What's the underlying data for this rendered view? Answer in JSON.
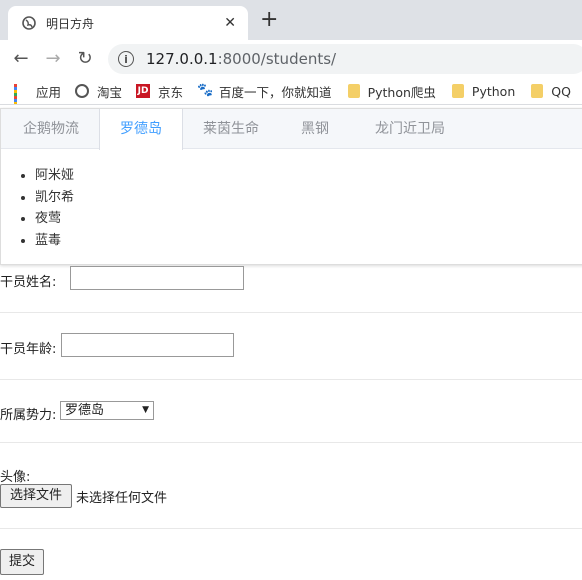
{
  "browser": {
    "tab_title": "明日方舟",
    "tab_close": "✕",
    "new_tab": "+",
    "back": "←",
    "forward": "→",
    "reload": "↻",
    "info": "i",
    "url_host": "127.0.0.1",
    "url_rest": ":8000/students/"
  },
  "bookmarks": [
    {
      "label": "应用",
      "icon": "apps-grid-icon"
    },
    {
      "label": "淘宝",
      "icon": "globe-icon"
    },
    {
      "label": "京东",
      "icon": "jd-icon"
    },
    {
      "label": "百度一下，你就知道",
      "icon": "baidu-paw-icon"
    },
    {
      "label": "Python爬虫",
      "icon": "folder-icon"
    },
    {
      "label": "Python",
      "icon": "folder-icon"
    },
    {
      "label": "QQ",
      "icon": "folder-icon"
    }
  ],
  "tabs": [
    {
      "label": "企鹅物流"
    },
    {
      "label": "罗德岛"
    },
    {
      "label": "莱茵生命"
    },
    {
      "label": "黑钢"
    },
    {
      "label": "龙门近卫局"
    }
  ],
  "active_tab": "罗德岛",
  "members": [
    "阿米娅",
    "凯尔希",
    "夜莺",
    "蓝毒"
  ],
  "form": {
    "name_label": "干员姓名:",
    "name_value": "",
    "age_label": "干员年龄:",
    "age_value": "",
    "faction_label": "所属势力:",
    "faction_selected": "罗德岛",
    "avatar_label": "头像:",
    "file_button": "选择文件",
    "file_status": "未选择任何文件",
    "submit_label": "提交"
  },
  "colors": {
    "accent": "#409eff",
    "tab_inactive": "#909399"
  }
}
